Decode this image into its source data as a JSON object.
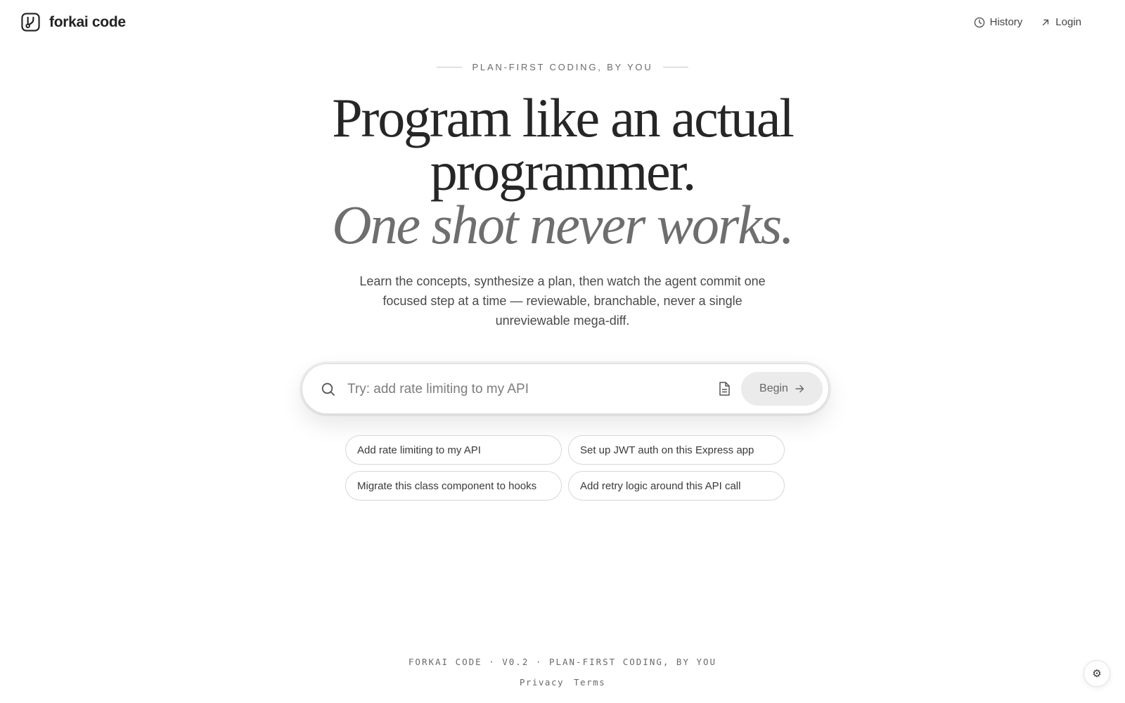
{
  "header": {
    "brand_name": "forkai code",
    "nav": [
      {
        "label": "History",
        "icon": "clock-icon"
      },
      {
        "label": "Login",
        "icon": "arrow-up-right-icon"
      }
    ]
  },
  "hero": {
    "eyebrow": "PLAN-FIRST CODING, BY YOU",
    "headline_line1": "Program like an actual",
    "headline_line2": "programmer.",
    "headline_italic": "One shot never works.",
    "subtext": "Learn the concepts, synthesize a plan, then watch the agent commit one focused step at a time — reviewable, branchable, never a single unreviewable mega-diff."
  },
  "search": {
    "placeholder": "Try: add rate limiting to my API",
    "value": "",
    "begin_label": "Begin",
    "begin_icon": "arrow-right-icon",
    "attach_icon": "document-icon"
  },
  "suggestions": [
    "Add rate limiting to my API",
    "Set up JWT auth on this Express app",
    "Migrate this class component to hooks",
    "Add retry logic around this API call"
  ],
  "footer": {
    "line": "FORKAI CODE · V0.2 · PLAN-FIRST CODING, BY YOU",
    "links": [
      "Privacy",
      "Terms"
    ]
  },
  "settings": {
    "glyph": "⚙",
    "icon": "gear-icon"
  },
  "colors": {
    "text_primary": "#262626",
    "text_muted": "#6e6e6e",
    "button_bg": "#ebebeb",
    "border": "#d7d7d7"
  }
}
